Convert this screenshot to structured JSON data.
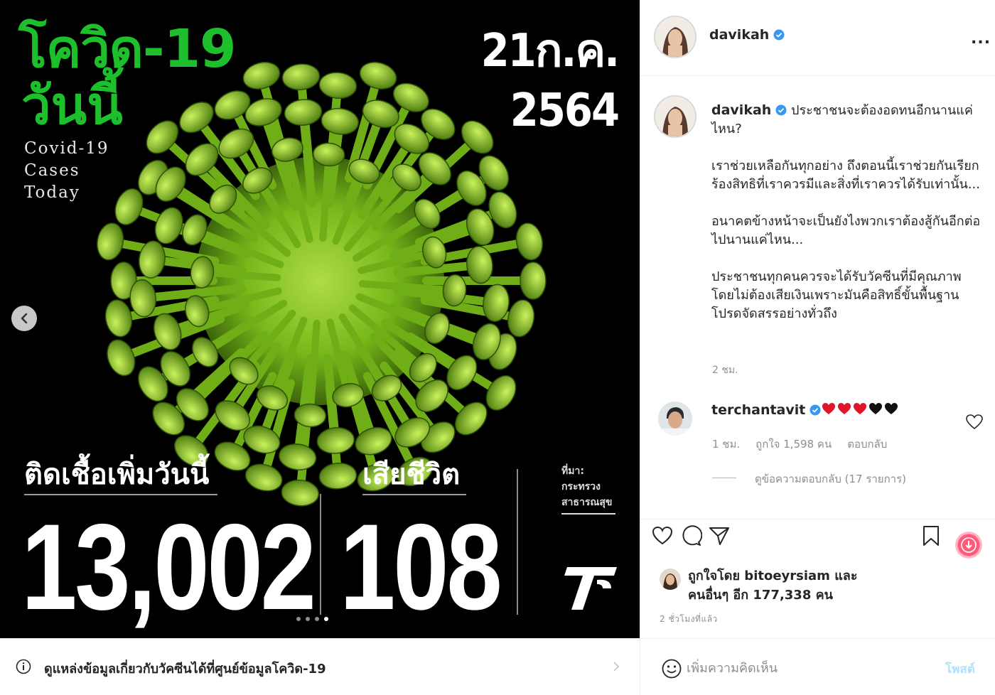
{
  "post_image": {
    "title_line1": "โควิด-19",
    "title_line2": "วันนี้",
    "subtitle_lines": [
      "Covid-19",
      "Cases",
      "Today"
    ],
    "date_line1": "21ก.ค.",
    "date_line2": "2564",
    "infected_label": "ติดเชื้อเพิ่มวันนี้",
    "infected_value": "13,002",
    "deaths_label": "เสียชีวิต",
    "deaths_value": "108",
    "source_lines": [
      "ที่มา:",
      "กระทรวง",
      "สาธารณสุข"
    ],
    "carousel_total": 4,
    "carousel_active_index": 4,
    "colors": {
      "title_green": "#1dbf2c",
      "virus_green": "#7ec21b"
    }
  },
  "info_banner": {
    "text": "ดูแหล่งข้อมูลเกี่ยวกับวัคซีนได้ที่ศูนย์ข้อมูลโควิด-19",
    "icon": "info-icon"
  },
  "header": {
    "username": "davikah",
    "verified": true,
    "more_label": "..."
  },
  "caption": {
    "username": "davikah",
    "first_line": "ประชาชนจะต้องอดทนอีกนานแค่ไหน?",
    "paragraphs": [
      "เราช่วยเหลือกันทุกอย่าง ถึงตอนนี้เราช่วยกันเรียกร้องสิทธิที่เราควรมีและสิ่งที่เราควรได้รับเท่านั้น...",
      "อนาคตข้างหน้าจะเป็นยังไงพวกเราต้องสู้กันอีกต่อไปนานแค่ไหน...",
      "ประชาชนทุกคนควรจะได้รับวัคซีนที่มีคุณภาพ โดยไม่ต้องเสียเงินเพราะมันคือสิทธิ์ขั้นพื้นฐาน โปรดจัดสรรอย่างทั่วถึง"
    ],
    "time": "2 ชม."
  },
  "comment": {
    "username": "terchantavit",
    "hearts": [
      "red",
      "red",
      "red",
      "black",
      "black"
    ],
    "time": "1 ชม.",
    "likes": "ถูกใจ 1,598 คน",
    "reply_label": "ตอบกลับ",
    "view_replies": "ดูข้อความตอบกลับ (17 รายการ)"
  },
  "actions": {
    "icons": [
      "heart-icon",
      "comment-icon",
      "share-icon",
      "bookmark-icon"
    ]
  },
  "likes": {
    "line1": "ถูกใจโดย bitoeyrsiam และ",
    "line2": "คนอื่นๆ อีก 177,338 คน"
  },
  "post_time": "2 ชั่วโมงที่แล้ว",
  "comment_input": {
    "placeholder": "เพิ่มความคิดเห็น",
    "post_label": "โพสต์"
  }
}
